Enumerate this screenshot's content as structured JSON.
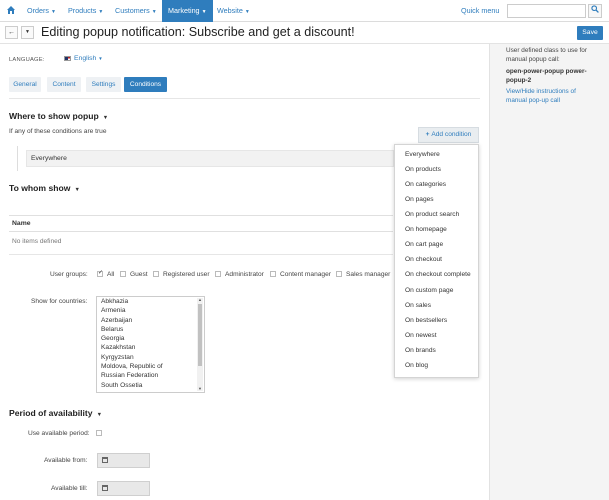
{
  "navbar": {
    "menus": [
      {
        "label": "Orders"
      },
      {
        "label": "Products"
      },
      {
        "label": "Customers"
      },
      {
        "label": "Marketing"
      },
      {
        "label": "Website"
      }
    ],
    "quick_menu": "Quick menu",
    "search_placeholder": ""
  },
  "header": {
    "title": "Editing popup notification: Subscribe and get a discount!",
    "save_label": "Save"
  },
  "sidebar": {
    "description": "User defined class to use for manual popup call:",
    "class_name": "open-power-popup power-popup-2",
    "instructions_link": "View/Hide instructions of manual pop-up call"
  },
  "language": {
    "label": "LANGUAGE:",
    "value": "English"
  },
  "tabs": [
    {
      "label": "General"
    },
    {
      "label": "Content"
    },
    {
      "label": "Settings"
    },
    {
      "label": "Conditions"
    }
  ],
  "where": {
    "heading": "Where to show popup",
    "hint": "If any of these conditions are true",
    "add_condition": "Add condition",
    "condition": "Everywhere"
  },
  "dropdown": {
    "items": [
      "Everywhere",
      "On products",
      "On categories",
      "On pages",
      "On product search",
      "On homepage",
      "On cart page",
      "On checkout",
      "On checkout complete",
      "On custom page",
      "On sales",
      "On bestsellers",
      "On newest",
      "On brands",
      "On blog"
    ]
  },
  "whom": {
    "heading": "To whom show",
    "table_header": "Name",
    "empty": "No items defined",
    "user_groups_label": "User groups:",
    "user_groups": [
      "All",
      "Guest",
      "Registered user",
      "Administrator",
      "Content manager",
      "Sales manager"
    ],
    "countries_label": "Show for countries:",
    "countries": [
      "Abkhazia",
      "Armenia",
      "Azerbaijan",
      "Belarus",
      "Georgia",
      "Kazakhstan",
      "Kyrgyzstan",
      "Moldova, Republic of",
      "Russian Federation",
      "South Ossetia"
    ]
  },
  "period": {
    "heading": "Period of availability",
    "use_label": "Use available period:",
    "from_label": "Available from:",
    "till_label": "Available till:"
  }
}
